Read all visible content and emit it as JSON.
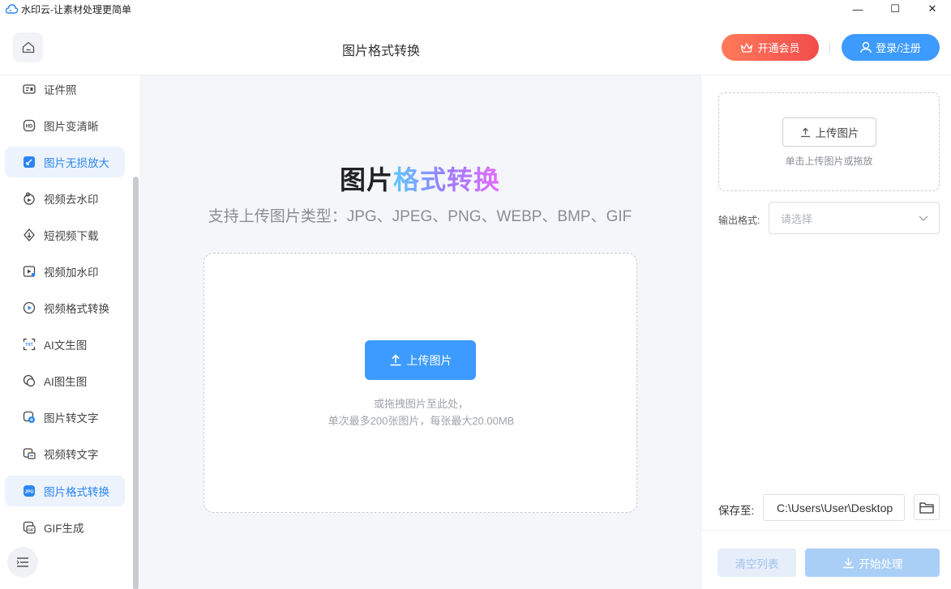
{
  "window": {
    "title": "水印云-让素材处理更简单",
    "minimize": "—",
    "maximize": "☐",
    "close": "✕"
  },
  "header": {
    "page_title": "图片格式转换",
    "vip_label": "开通会员",
    "login_label": "登录/注册"
  },
  "sidebar": {
    "items": [
      {
        "label": "证件照",
        "icon": "id-card-icon"
      },
      {
        "label": "图片变清晰",
        "icon": "hd-icon"
      },
      {
        "label": "图片无损放大",
        "icon": "enlarge-icon",
        "active": true
      },
      {
        "label": "视频去水印",
        "icon": "video-remove-watermark-icon"
      },
      {
        "label": "短视频下载",
        "icon": "download-icon"
      },
      {
        "label": "视频加水印",
        "icon": "video-add-watermark-icon"
      },
      {
        "label": "视频格式转换",
        "icon": "play-circle-icon"
      },
      {
        "label": "AI文生图",
        "icon": "ai-text-image-icon"
      },
      {
        "label": "AI图生图",
        "icon": "ai-image-image-icon"
      },
      {
        "label": "图片转文字",
        "icon": "image-text-icon"
      },
      {
        "label": "视频转文字",
        "icon": "video-text-icon"
      },
      {
        "label": "图片格式转换",
        "icon": "jpg-icon",
        "active": true
      },
      {
        "label": "GIF生成",
        "icon": "gif-icon"
      }
    ]
  },
  "main": {
    "hero_title_part1": "图片",
    "hero_title_part2": "格式转换",
    "hero_subtitle": "支持上传图片类型：JPG、JPEG、PNG、WEBP、BMP、GIF",
    "upload_label": "上传图片",
    "hint_line1": "或拖拽图片至此处，",
    "hint_line2": "单次最多200张图片，每张最大20.00MB"
  },
  "right_panel": {
    "upload_label": "上传图片",
    "upload_hint": "单击上传图片或拖放",
    "output_format_label": "输出格式:",
    "output_format_placeholder": "请选择",
    "save_to_label": "保存至:",
    "save_path": "C:\\Users\\User\\Desktop",
    "clear_label": "清空列表",
    "start_label": "开始处理"
  },
  "colors": {
    "accent": "#3d9bff",
    "vip_gradient_start": "#ff7a5a",
    "vip_gradient_end": "#f24c4c",
    "active_bg": "#ecf3fd",
    "main_bg": "#f4f6fa"
  }
}
